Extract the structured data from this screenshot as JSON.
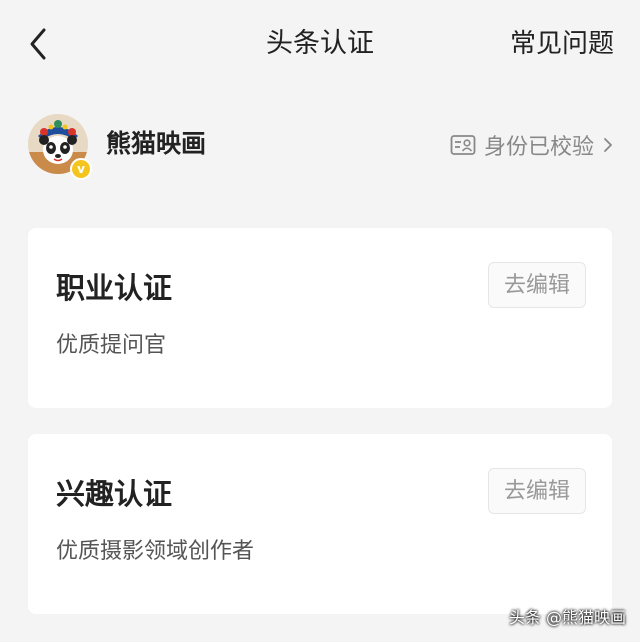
{
  "nav": {
    "title": "头条认证",
    "faq_label": "常见问题"
  },
  "profile": {
    "name": "熊猫映画",
    "verify_status": "身份已校验",
    "badge": "v"
  },
  "cards": [
    {
      "title": "职业认证",
      "description": "优质提问官",
      "edit_label": "去编辑"
    },
    {
      "title": "兴趣认证",
      "description": "优质摄影领域创作者",
      "edit_label": "去编辑"
    }
  ],
  "watermark": "头条 @熊猫映画",
  "colors": {
    "background": "#f4f4f4",
    "card": "#ffffff",
    "muted_text": "#888888",
    "badge": "#f4c51e"
  }
}
